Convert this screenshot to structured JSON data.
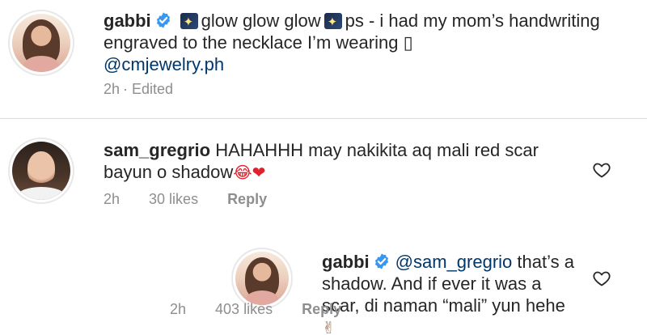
{
  "caption": {
    "username": "gabbi",
    "verified_icon": "verified-badge-icon",
    "emoji_1": "sparkle-icon",
    "text_part_1": "glow glow glow",
    "emoji_2": "sparkle-icon",
    "text_part_2": "ps - i had my mom’s handwriting engraved to the necklace I’m wearing",
    "missing_glyph": "▯",
    "mention": "@cmjewelry.ph",
    "time": "2h",
    "edited": "· Edited"
  },
  "comment": {
    "username": "sam_gregrio",
    "text": "HAHAHHH may nakikita aq mali red scar bayun o shadow",
    "emoji": "😂❤",
    "time": "2h",
    "likes": "30 likes",
    "reply_label": "Reply"
  },
  "reply": {
    "username": "gabbi",
    "mention": "@sam_gregrio",
    "text": "that’s a shadow. And if ever it was a scar, di naman “mali” yun hehe",
    "emoji": "✌",
    "time": "2h",
    "likes": "403 likes",
    "reply_label": "Reply"
  },
  "colors": {
    "verified_blue": "#3897f0",
    "mention_blue": "#00376b",
    "meta_gray": "#8e8e8e"
  }
}
